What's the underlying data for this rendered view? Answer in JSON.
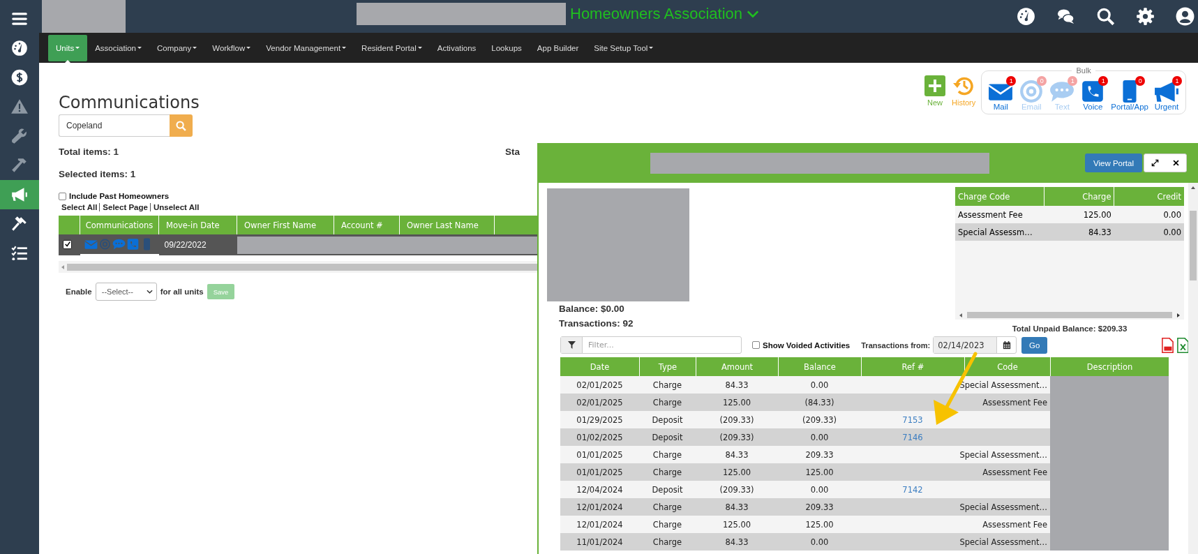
{
  "top_bar": {
    "title": "Homeowners Association"
  },
  "sidebar": {
    "items": [
      {
        "kind": "menu",
        "selected": false
      },
      {
        "kind": "gauge",
        "selected": false
      },
      {
        "kind": "dollar",
        "selected": false
      },
      {
        "kind": "warning",
        "selected": false
      },
      {
        "kind": "wrench",
        "selected": false
      },
      {
        "kind": "hammer",
        "selected": false
      },
      {
        "kind": "megaphone",
        "selected": true
      },
      {
        "kind": "gavel",
        "selected": false
      },
      {
        "kind": "checklist",
        "selected": false
      }
    ]
  },
  "nav": [
    {
      "label": "Units",
      "dropdown": true,
      "selected": true
    },
    {
      "label": "Association",
      "dropdown": true,
      "selected": false
    },
    {
      "label": "Company",
      "dropdown": true,
      "selected": false
    },
    {
      "label": "Workflow",
      "dropdown": true,
      "selected": false
    },
    {
      "label": "Vendor Management",
      "dropdown": true,
      "selected": false
    },
    {
      "label": "Resident Portal",
      "dropdown": true,
      "selected": false
    },
    {
      "label": "Activations",
      "dropdown": false,
      "selected": false
    },
    {
      "label": "Lookups",
      "dropdown": false,
      "selected": false
    },
    {
      "label": "App Builder",
      "dropdown": false,
      "selected": false
    },
    {
      "label": "Site Setup Tool",
      "dropdown": true,
      "selected": false
    }
  ],
  "page": {
    "title": "Communications",
    "search": {
      "value": "Copeland"
    },
    "total_items": "Total items: 1",
    "selected_items": "Selected items: 1",
    "cut_label": "Sta",
    "include_past": {
      "label": "Include Past Homeowners",
      "checked": false
    },
    "select_links": [
      "Select All",
      "Select Page",
      "Unselect All"
    ],
    "actions": [
      {
        "kind": "new",
        "label": "New"
      },
      {
        "kind": "history",
        "label": "History"
      }
    ],
    "bulk": {
      "legend": "Bulk",
      "items": [
        {
          "kind": "mail",
          "label": "Mail",
          "count": "1",
          "enabled": true
        },
        {
          "kind": "email",
          "label": "Email",
          "count": "0",
          "enabled": false
        },
        {
          "kind": "text",
          "label": "Text",
          "count": "1",
          "enabled": false
        },
        {
          "kind": "voice",
          "label": "Voice",
          "count": "1",
          "enabled": true
        },
        {
          "kind": "portal",
          "label": "Portal/App",
          "count": "0",
          "enabled": true
        },
        {
          "kind": "urgent",
          "label": "Urgent",
          "count": "1",
          "enabled": true
        }
      ]
    },
    "units_table": {
      "columns": [
        "Communications",
        "Move-in Date",
        "Owner First Name",
        "Account #",
        "Owner Last Name"
      ],
      "rows": [
        {
          "checked": true,
          "move_in": "09/22/2022",
          "channels": [
            {
              "kind": "mail",
              "enabled": true
            },
            {
              "kind": "email",
              "enabled": false
            },
            {
              "kind": "text",
              "enabled": true
            },
            {
              "kind": "voice",
              "enabled": true
            },
            {
              "kind": "portal",
              "enabled": false
            }
          ]
        }
      ]
    },
    "enable_row": {
      "label": "Enable",
      "select": "--Select--",
      "suffix": "for all units",
      "button": "Save"
    }
  },
  "modal": {
    "button": "View Portal",
    "balance": "Balance: $0.00",
    "transactions": "Transactions: 92",
    "charges": {
      "columns": [
        "Charge Code",
        "Charge",
        "Credit"
      ],
      "rows": [
        [
          "Assessment Fee",
          "125.00",
          "0.00"
        ],
        [
          "Special Assessm…",
          "84.33",
          "0.00"
        ]
      ]
    },
    "total_unpaid": "Total Unpaid Balance: $209.33",
    "filter_placeholder": "Filter...",
    "show_voided": {
      "label": "Show Voided Activities",
      "checked": false
    },
    "from_label": "Transactions from:",
    "from_date": "02/14/2023",
    "go": "Go",
    "table": {
      "columns": [
        "Date",
        "Type",
        "Amount",
        "Balance",
        "Ref #",
        "Code",
        "Description"
      ],
      "rows": [
        {
          "date": "02/01/2025",
          "type": "Charge",
          "amount": "84.33",
          "balance": "0.00",
          "ref": "",
          "code": "Special Assessment…"
        },
        {
          "date": "02/01/2025",
          "type": "Charge",
          "amount": "125.00",
          "balance": "(84.33)",
          "ref": "",
          "code": "Assessment Fee"
        },
        {
          "date": "01/29/2025",
          "type": "Deposit",
          "amount": "(209.33)",
          "balance": "(209.33)",
          "ref": "7153",
          "code": ""
        },
        {
          "date": "01/02/2025",
          "type": "Deposit",
          "amount": "(209.33)",
          "balance": "0.00",
          "ref": "7146",
          "code": ""
        },
        {
          "date": "01/01/2025",
          "type": "Charge",
          "amount": "84.33",
          "balance": "209.33",
          "ref": "",
          "code": "Special Assessment…"
        },
        {
          "date": "01/01/2025",
          "type": "Charge",
          "amount": "125.00",
          "balance": "125.00",
          "ref": "",
          "code": "Assessment Fee"
        },
        {
          "date": "12/04/2024",
          "type": "Deposit",
          "amount": "(209.33)",
          "balance": "0.00",
          "ref": "7142",
          "code": ""
        },
        {
          "date": "12/01/2024",
          "type": "Charge",
          "amount": "84.33",
          "balance": "209.33",
          "ref": "",
          "code": "Special Assessment…"
        },
        {
          "date": "12/01/2024",
          "type": "Charge",
          "amount": "125.00",
          "balance": "125.00",
          "ref": "",
          "code": "Assessment Fee"
        },
        {
          "date": "11/01/2024",
          "type": "Charge",
          "amount": "84.33",
          "balance": "0.00",
          "ref": "",
          "code": "Special Assessment…"
        }
      ]
    }
  }
}
